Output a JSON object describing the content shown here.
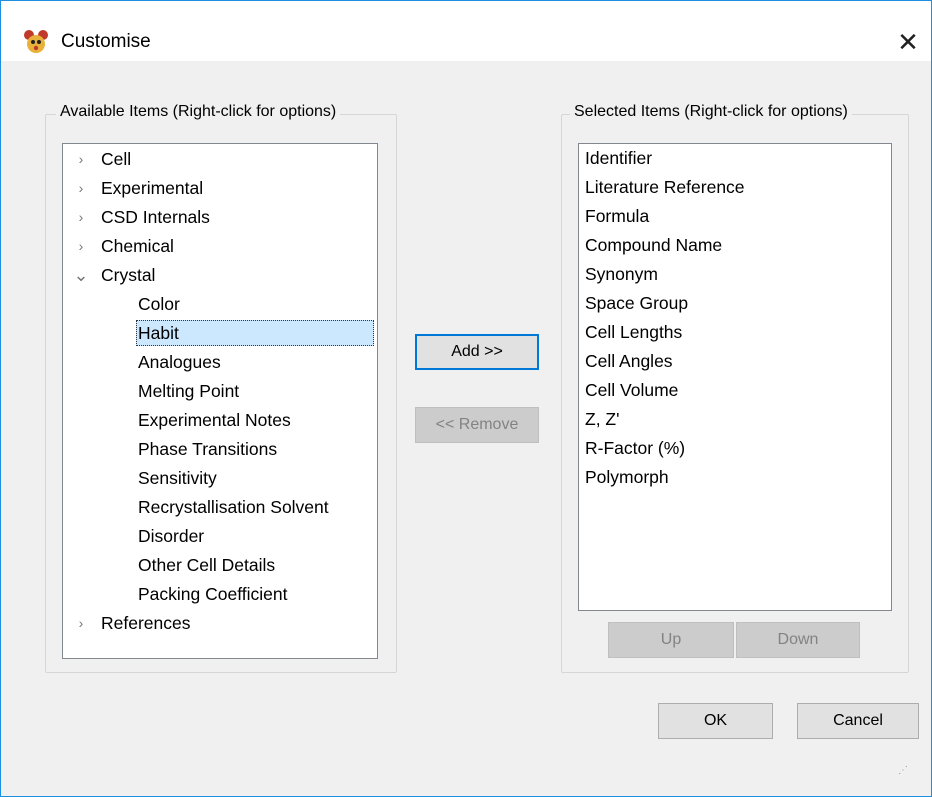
{
  "window": {
    "title": "Customise",
    "close_symbol": "✕"
  },
  "available": {
    "legend": "Available Items (Right-click for options)",
    "categories": [
      {
        "label": "Cell",
        "toggle": "›"
      },
      {
        "label": "Experimental",
        "toggle": "›"
      },
      {
        "label": "CSD Internals",
        "toggle": "›"
      },
      {
        "label": "Chemical",
        "toggle": "›"
      },
      {
        "label": "Crystal",
        "toggle": "⌄"
      }
    ],
    "crystal_children": [
      "Color",
      "Habit",
      "Analogues",
      "Melting Point",
      "Experimental Notes",
      "Phase Transitions",
      "Sensitivity",
      "Recrystallisation Solvent",
      "Disorder",
      "Other Cell Details",
      "Packing Coefficient"
    ],
    "selected_child": "Habit",
    "last_category": {
      "label": "References",
      "toggle": "›"
    }
  },
  "selected": {
    "legend": "Selected Items (Right-click for options)",
    "items": [
      "Identifier",
      "Literature Reference",
      "Formula",
      "Compound Name",
      "Synonym",
      "Space Group",
      "Cell Lengths",
      "Cell Angles",
      "Cell Volume",
      "Z, Z'",
      "R-Factor (%)",
      "Polymorph"
    ]
  },
  "buttons": {
    "add": "Add >>",
    "remove": "<< Remove",
    "up": "Up",
    "down": "Down",
    "ok": "OK",
    "cancel": "Cancel"
  },
  "icons": {
    "app": "mouse-face-icon",
    "close": "close-icon",
    "grip": "resize-grip-icon"
  },
  "colors": {
    "selection": "#cce8ff",
    "accent": "#0078d7",
    "window_border": "#1e8fe0"
  }
}
